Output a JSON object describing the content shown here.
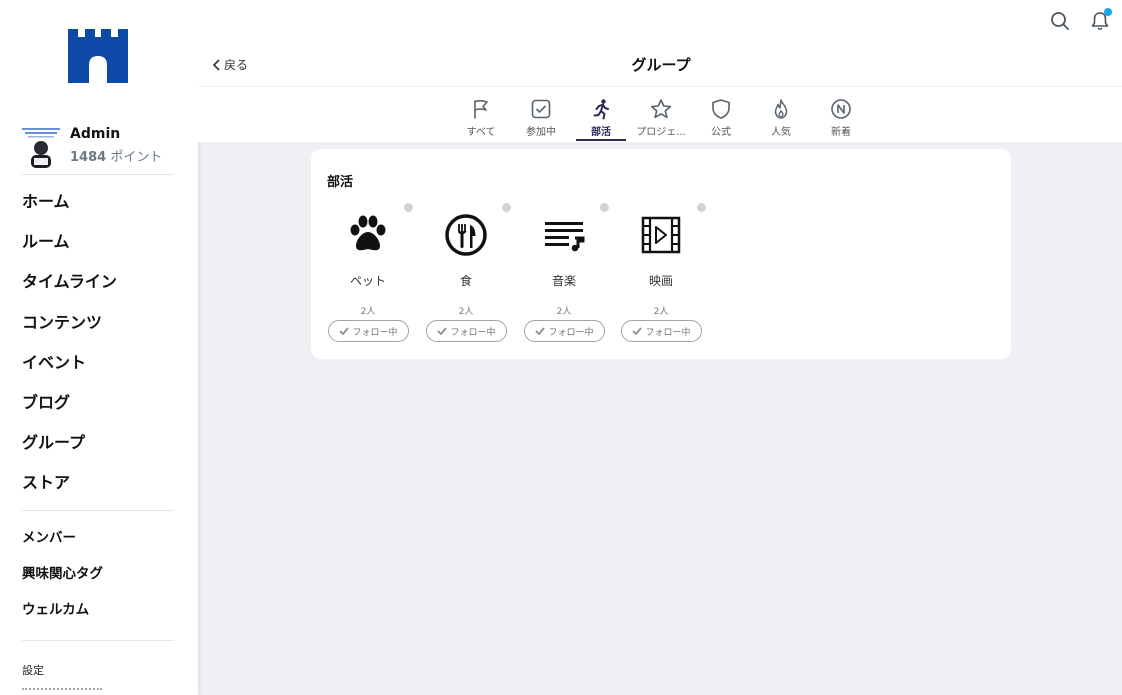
{
  "sidebar": {
    "user": {
      "name": "Admin",
      "points_value": "1484",
      "points_unit": "ポイント"
    },
    "nav_main": [
      "ホーム",
      "ルーム",
      "タイムライン",
      "コンテンツ",
      "イベント",
      "ブログ",
      "グループ",
      "ストア"
    ],
    "nav_sub": [
      "メンバー",
      "興味関心タグ",
      "ウェルカム"
    ],
    "settings": "設定"
  },
  "header": {
    "back_label": "戻る",
    "title": "グループ",
    "notification_dot_color": "#1aa3e8"
  },
  "tabs": [
    {
      "label": "すべて",
      "icon": "flag-icon"
    },
    {
      "label": "参加中",
      "icon": "checkbox-icon"
    },
    {
      "label": "部活",
      "icon": "running-icon",
      "active": true
    },
    {
      "label": "プロジェ...",
      "icon": "star-icon"
    },
    {
      "label": "公式",
      "icon": "shield-icon"
    },
    {
      "label": "人気",
      "icon": "fire-icon"
    },
    {
      "label": "新着",
      "icon": "new-icon"
    }
  ],
  "section": {
    "title": "部活",
    "groups": [
      {
        "name": "ペット",
        "count": "2人",
        "follow_label": "フォロー中",
        "icon": "paw-icon"
      },
      {
        "name": "食",
        "count": "2人",
        "follow_label": "フォロー中",
        "icon": "dining-icon"
      },
      {
        "name": "音楽",
        "count": "2人",
        "follow_label": "フォロー中",
        "icon": "music-list-icon"
      },
      {
        "name": "映画",
        "count": "2人",
        "follow_label": "フォロー中",
        "icon": "film-icon"
      }
    ]
  },
  "colors": {
    "accent": "#2b2a55",
    "logo": "#0d4aa8",
    "background": "#eef0f4"
  }
}
